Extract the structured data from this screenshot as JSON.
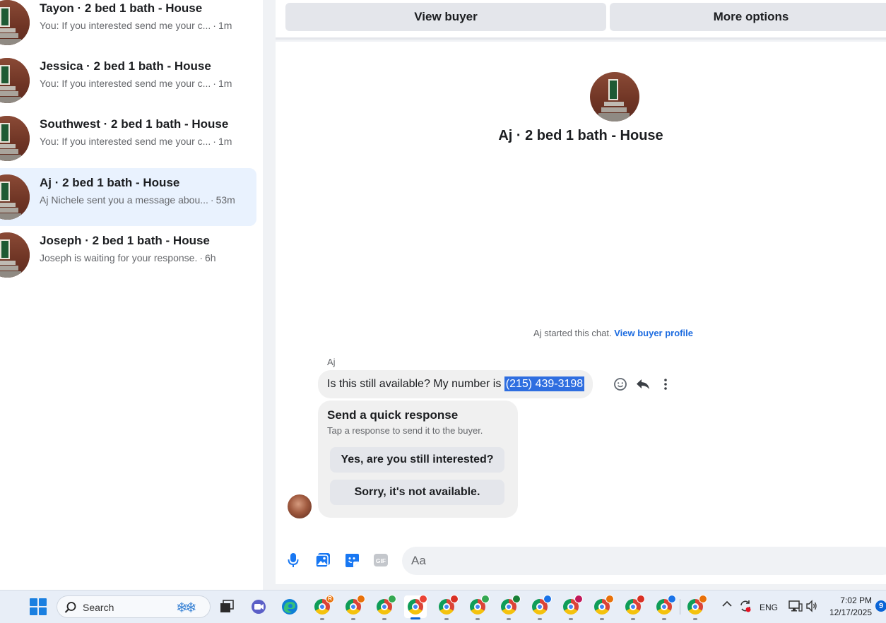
{
  "conversations": [
    {
      "name": "Tayon · 2 bed 1 bath - House",
      "preview": "You: If you interested send me your c...",
      "time": "1m"
    },
    {
      "name": "Jessica · 2 bed 1 bath - House",
      "preview": "You: If you interested send me your c...",
      "time": "1m"
    },
    {
      "name": "Southwest · 2 bed 1 bath - House",
      "preview": "You: If you interested send me your c...",
      "time": "1m"
    },
    {
      "name": "Aj · 2 bed 1 bath - House",
      "preview": "Aj Nichele sent you a message abou...",
      "time": "53m"
    },
    {
      "name": "Joseph · 2 bed 1 bath - House",
      "preview": "Joseph is waiting for your response.",
      "time": "6h"
    }
  ],
  "separator": "·",
  "topbar": {
    "view_buyer": "View buyer",
    "more_options": "More options"
  },
  "chat": {
    "title": "Aj · 2 bed 1 bath - House",
    "started_text": "Aj started this chat.",
    "view_profile_link": "View buyer profile",
    "sender": "Aj",
    "message_text": "Is this still available? My number is",
    "message_phone": "(215) 439-3198",
    "quick_title": "Send a quick response",
    "quick_sub": "Tap a response to send it to the buyer.",
    "quick_yes": "Yes, are you still interested?",
    "quick_sorry": "Sorry, it's not available.",
    "composer_placeholder": "Aa",
    "gif_label": "GIF"
  },
  "taskbar": {
    "search_label": "Search",
    "language": "ENG",
    "time": "7:02 PM",
    "date": "12/17/2025",
    "notification_count": "9",
    "chrome_badge_letter": "R"
  },
  "colors": {
    "accent_blue": "#1d6ce0",
    "selection_highlight": "#2f6ee0",
    "active_conversation_bg": "#e9f2fe"
  }
}
